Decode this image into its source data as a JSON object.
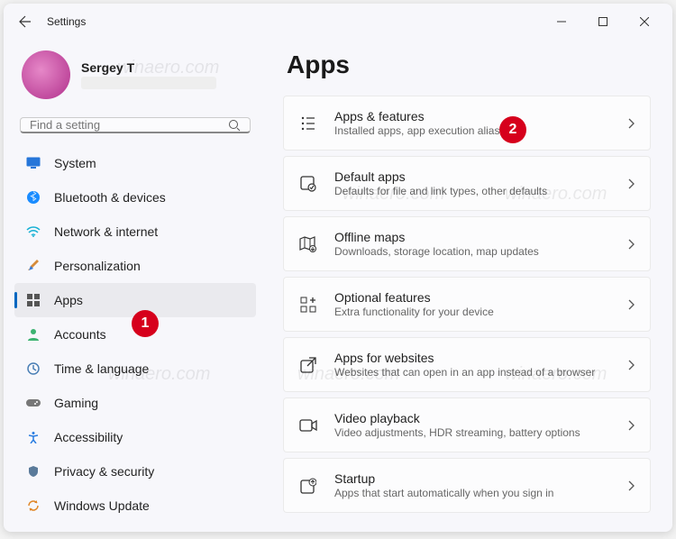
{
  "window": {
    "title": "Settings"
  },
  "profile": {
    "name": "Sergey T"
  },
  "search": {
    "placeholder": "Find a setting"
  },
  "sidebar": {
    "items": [
      {
        "label": "System"
      },
      {
        "label": "Bluetooth & devices"
      },
      {
        "label": "Network & internet"
      },
      {
        "label": "Personalization"
      },
      {
        "label": "Apps"
      },
      {
        "label": "Accounts"
      },
      {
        "label": "Time & language"
      },
      {
        "label": "Gaming"
      },
      {
        "label": "Accessibility"
      },
      {
        "label": "Privacy & security"
      },
      {
        "label": "Windows Update"
      }
    ]
  },
  "page": {
    "title": "Apps"
  },
  "cards": [
    {
      "title": "Apps & features",
      "sub": "Installed apps, app execution aliases"
    },
    {
      "title": "Default apps",
      "sub": "Defaults for file and link types, other defaults"
    },
    {
      "title": "Offline maps",
      "sub": "Downloads, storage location, map updates"
    },
    {
      "title": "Optional features",
      "sub": "Extra functionality for your device"
    },
    {
      "title": "Apps for websites",
      "sub": "Websites that can open in an app instead of a browser"
    },
    {
      "title": "Video playback",
      "sub": "Video adjustments, HDR streaming, battery options"
    },
    {
      "title": "Startup",
      "sub": "Apps that start automatically when you sign in"
    }
  ],
  "badges": {
    "b1": "1",
    "b2": "2"
  },
  "watermark": "winaero.com"
}
